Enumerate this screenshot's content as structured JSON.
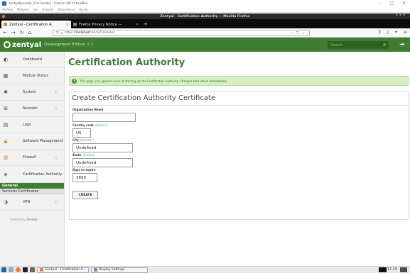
{
  "vbox": {
    "title": "zentyalpesado [Corriendo] - Oracle VM VirtualBox",
    "menu": [
      "Archivo",
      "Máquina",
      "Ver",
      "Entrada",
      "Dispositivos",
      "Ayuda"
    ],
    "minimize": "–",
    "restore": "□",
    "close": "✕"
  },
  "firefox": {
    "window_title": "Zentyal - Certification Authority — Mozilla Firefox",
    "tabs": [
      {
        "label": "Zentyal - Certification A",
        "close": "✕",
        "favicon_color": "#e0823d",
        "active": true
      },
      {
        "label": "Firefox Privacy Notice —",
        "close": "✕",
        "favicon_color": "#4a4a4a",
        "active": false
      }
    ],
    "new_tab": "+",
    "url_prefix": "https://",
    "url_host": "localhost",
    "url_rest": ":8443/CA/Index",
    "more_icon": "···",
    "pocket_icon": "⛉",
    "star_icon": "☆",
    "library_icon": "⫼",
    "sidebar_icon": "▯",
    "extension_icon": "✦",
    "menu_icon": "≡"
  },
  "zentyal": {
    "logo": "zentyal",
    "edition": "Development Edition",
    "version": "6.2",
    "search_placeholder": "Search...",
    "search_icon": "⌕",
    "logout_icon": "⇥",
    "brand_color": "#3f7d32"
  },
  "sidebar": {
    "items": [
      {
        "label": "Dashboard",
        "icon": "◐",
        "arrow": ""
      },
      {
        "label": "Module Status",
        "icon": "▦",
        "arrow": ""
      },
      {
        "label": "System",
        "icon": "✱",
        "arrow": "‹"
      },
      {
        "label": "Network",
        "icon": "⊞",
        "arrow": "‹"
      },
      {
        "label": "Logs",
        "icon": "▤",
        "arrow": ""
      },
      {
        "label": "Software Management",
        "icon": "▲",
        "arrow": "‹"
      },
      {
        "label": "Firewall",
        "icon": "▥",
        "arrow": "‹"
      },
      {
        "label": "Certification Authority",
        "icon": "◆",
        "arrow": "⌄"
      }
    ],
    "sub_head": "General",
    "sub_item": "Services Certificates",
    "vpn": {
      "label": "VPN",
      "icon": "◑",
      "arrow": "‹"
    },
    "footer_text": "Created by",
    "footer_link": "Zentyal"
  },
  "main": {
    "title": "Certification Authority",
    "info_icon": "i",
    "note": "This page only appears once at starting up the Certification Authority. Changes take effect immediately.",
    "form_title": "Create Certification Authority Certificate",
    "fields": {
      "org_label": "Organization Name",
      "org_value": "",
      "country_label": "Country code",
      "country_optional": "Optional",
      "country_value": "US",
      "city_label": "City",
      "city_optional": "Optional",
      "city_value": "Undefined",
      "state_label": "State",
      "state_optional": "Optional",
      "state_value": "Undefined",
      "days_label": "Days to expire",
      "days_value": "3650"
    },
    "create_button": "CREATE"
  },
  "taskbar": {
    "tasks": [
      "Zentyal - Certification A...",
      "Display Settings"
    ],
    "clock": "17:19"
  }
}
